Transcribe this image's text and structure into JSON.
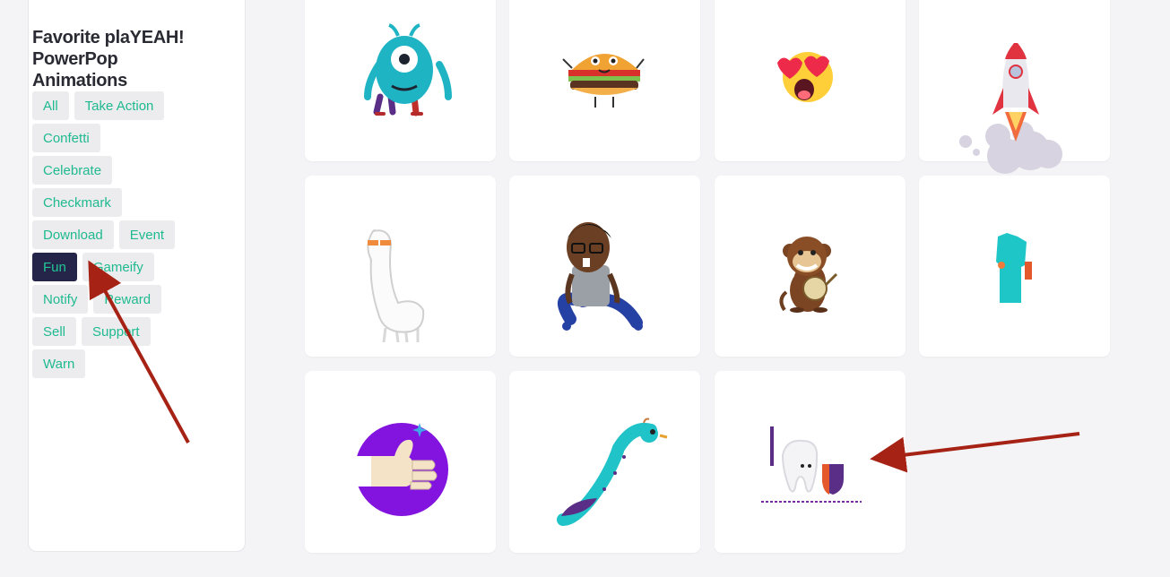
{
  "sidebar": {
    "title": "Favorite plaYEAH! PowerPop Animations",
    "filters": {
      "all": "All",
      "take_action": "Take Action",
      "confetti": "Confetti",
      "celebrate": "Celebrate",
      "checkmark": "Checkmark",
      "download": "Download",
      "event": "Event",
      "fun": "Fun",
      "gameify": "Gameify",
      "notify": "Notify",
      "reward": "Reward",
      "sell": "Sell",
      "support": "Support",
      "warn": "Warn"
    },
    "active_filter": "Fun"
  },
  "animations": [
    {
      "icon": "one-eyed-monster-icon"
    },
    {
      "icon": "hamburger-character-icon"
    },
    {
      "icon": "heart-eyes-emoji-icon"
    },
    {
      "icon": "rocket-launch-icon"
    },
    {
      "icon": "llama-sunglasses-icon"
    },
    {
      "icon": "dancing-man-icon"
    },
    {
      "icon": "monkey-banjo-icon"
    },
    {
      "icon": "teal-shirt-icon"
    },
    {
      "icon": "thumbs-up-icon"
    },
    {
      "icon": "peacock-icon"
    },
    {
      "icon": "tooth-shield-icon"
    }
  ],
  "colors": {
    "tag_text": "#1fba8f",
    "tag_bg": "#ececef",
    "active_bg": "#25254a",
    "annotation_arrow": "#a52214"
  }
}
